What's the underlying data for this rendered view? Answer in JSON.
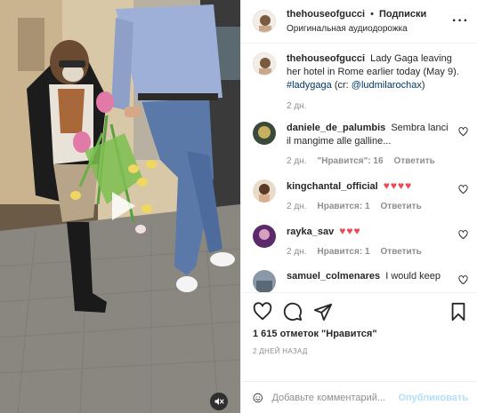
{
  "header": {
    "username": "thehouseofgucci",
    "separator": "•",
    "follow_label": "Подписки",
    "audio_label": "Оригинальная аудиодорожка",
    "more_label": "···"
  },
  "caption": {
    "username": "thehouseofgucci",
    "text_before": "Lady Gaga leaving her hotel in Rome earlier today (May 9).",
    "hashtag": "#ladygaga",
    "credit_prefix": "(cr:",
    "mention": "@ludmilarochax",
    "credit_suffix": ")",
    "time": "2 дн."
  },
  "comments": [
    {
      "username": "daniele_de_palumbis",
      "text": "Sembra lanci il mangime alle galline...",
      "time": "2 дн.",
      "likes": "\"Нравится\": 16",
      "reply": "Ответить"
    },
    {
      "username": "kingchantal_official",
      "text": "♥♥♥♥",
      "time": "2 дн.",
      "likes": "Нравится: 1",
      "reply": "Ответить"
    },
    {
      "username": "rayka_sav",
      "text": "♥♥♥",
      "time": "2 дн.",
      "likes": "Нравится: 1",
      "reply": "Ответить"
    },
    {
      "username": "samuel_colmenares",
      "text": "I would keep",
      "time": "",
      "likes": "",
      "reply": ""
    }
  ],
  "actions": {
    "likes_count": "1 615 отметок \"Нравится\"",
    "date": "2 ДНЕЙ НАЗАД"
  },
  "composer": {
    "placeholder": "Добавьте комментарий...",
    "publish_label": "Опубликовать"
  },
  "icons": {
    "play": "play-icon",
    "mute": "speaker-muted-icon",
    "like": "heart-icon",
    "comment": "comment-icon",
    "share": "paper-plane-icon",
    "save": "bookmark-icon",
    "emoji": "smiley-icon",
    "more": "more-horizontal-icon"
  },
  "colors": {
    "accent_link": "#00376b",
    "heart_red": "#ed4956",
    "publish_disabled": "#b2dffc",
    "muted_text": "#8e8e8e"
  }
}
